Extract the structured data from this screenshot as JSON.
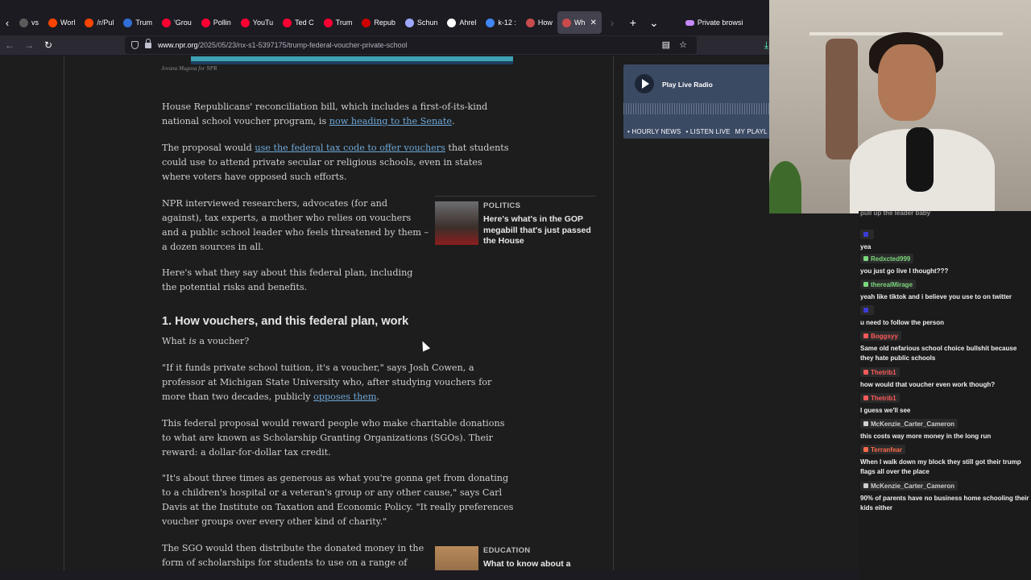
{
  "browser": {
    "tabs": [
      {
        "label": "vs",
        "favicon_color": "#5a5a5a"
      },
      {
        "label": "Worl",
        "favicon_color": "#ff4500"
      },
      {
        "label": "/r/Pul",
        "favicon_color": "#ff4500"
      },
      {
        "label": "Trum",
        "favicon_color": "#2f6fd6"
      },
      {
        "label": "'Grou",
        "favicon_color": "#ff0033"
      },
      {
        "label": "Pollin",
        "favicon_color": "#ff0033"
      },
      {
        "label": "YouTu",
        "favicon_color": "#ff0033"
      },
      {
        "label": "Ted C",
        "favicon_color": "#ff0033"
      },
      {
        "label": "Trum",
        "favicon_color": "#ff0033"
      },
      {
        "label": "Repub",
        "favicon_color": "#cc0000"
      },
      {
        "label": "Schun",
        "favicon_color": "#9ea7ff"
      },
      {
        "label": "Ahrel",
        "favicon_color": "#ffffff"
      },
      {
        "label": "k-12 :",
        "favicon_color": "#4285f4"
      },
      {
        "label": "How",
        "favicon_color": "#c94b4b"
      },
      {
        "label": "Wh",
        "favicon_color": "#c94b4b",
        "active": true
      }
    ],
    "private_label": "Private browsi",
    "url_domain": "www.npr.org",
    "url_path": "/2025/05/23/nx-s1-5397175/trump-federal-voucher-private-school"
  },
  "article": {
    "caption": "Jovana Mugosa for NPR",
    "p1": {
      "text": "House Republicans' reconciliation bill, which includes a first-of-its-kind national school voucher program, is ",
      "link": "now heading to the Senate",
      "after": "."
    },
    "p2": {
      "before": "The proposal would ",
      "link": "use the federal tax code to offer vouchers",
      "text": " that students could use to attend private secular or religious schools, even in states where voters have opposed such efforts."
    },
    "p3": "NPR interviewed researchers, advocates (for and against), tax experts, a mother who relies on vouchers and a public school leader who feels threatened by them – a dozen sources in all.",
    "p4": "Here's what they say about this federal plan, including the potential risks and benefits.",
    "h1": "1. How vouchers, and this federal plan, work",
    "p5_a": "What ",
    "p5_em": "is",
    "p5_b": " a voucher?",
    "p6": {
      "text": "\"If it funds private school tuition, it's a voucher,\" says Josh Cowen, a professor at Michigan State University who, after studying vouchers for more than two decades, publicly ",
      "link": "opposes them",
      "after": "."
    },
    "p7": "This federal proposal would reward people who make charitable donations to what are known as Scholarship Granting Organizations (SGOs). Their reward: a dollar-for-dollar tax credit.",
    "p8": "\"It's about three times as generous as what you're gonna get from donating to a children's hospital or a veteran's group or any other cause,\" says Carl Davis at the Institute on Taxation and Economic Policy. \"It really preferences voucher groups over every other kind of charity.\"",
    "p9": "The SGO would then distribute the donated money in the form of scholarships for students to use on a range of",
    "related1": {
      "label": "POLITICS",
      "title": "Here's what's in the GOP megabill that's just passed the House"
    },
    "related2": {
      "label": "EDUCATION",
      "title": "What to know about a"
    }
  },
  "radio": {
    "play_label": "Play Live Radio",
    "links": [
      "• HOURLY NEWS",
      "• LISTEN LIVE",
      "MY PLAYL"
    ]
  },
  "chat": [
    {
      "user": "",
      "text": "pull up the leader baby",
      "color": "#ffffff"
    },
    {
      "user": "",
      "text": "yea",
      "color": "#3b3bd6"
    },
    {
      "user": "Redxcted999",
      "text": "you just go live I thought???",
      "color": "#7dd87d"
    },
    {
      "user": "therealMirage",
      "text": "yeah like tiktok and i believe you use to on twitter",
      "color": "#7dd87d"
    },
    {
      "user": "",
      "text": "u need to follow the person",
      "color": "#3b3bd6"
    },
    {
      "user": "Boggsyy",
      "text": "Same old nefarious school choice bullshit because they hate public schools",
      "color": "#ff5a5a"
    },
    {
      "user": "Thetrib1",
      "text": "how would that voucher even work though?",
      "color": "#ff5a5a"
    },
    {
      "user": "Thetrib1",
      "text": "I guess we'll see",
      "color": "#ff5a5a"
    },
    {
      "user": "McKenzie_Carter_Cameron",
      "text": "this costs way more money in the long run",
      "color": "#d0d0d0"
    },
    {
      "user": "Terranfear",
      "text": "When I walk down my block they still got their trump flags all over the place",
      "color": "#ff6a4a"
    },
    {
      "user": "McKenzie_Carter_Cameron",
      "text": "90% of parents have no business home schooling their kids either",
      "color": "#d0d0d0"
    }
  ]
}
